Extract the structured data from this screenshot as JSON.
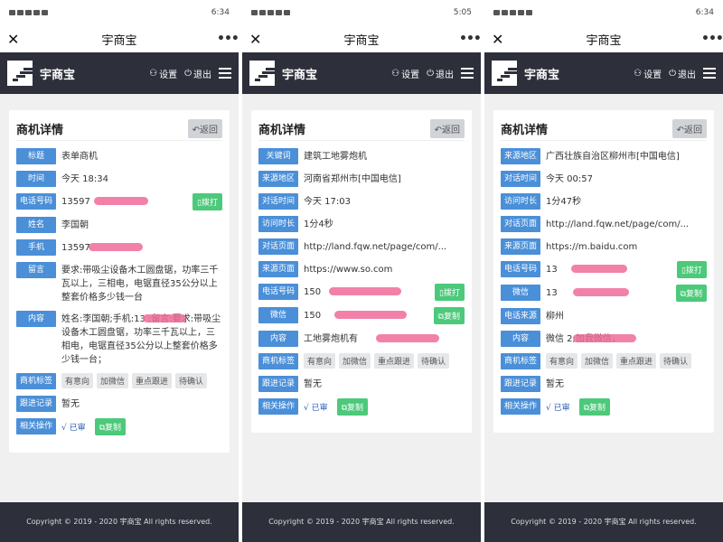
{
  "screens": [
    {
      "status_time": "6:34",
      "title": "宇商宝",
      "app_name": "宇商宝",
      "settings": "设置",
      "logout": "退出",
      "card_title": "商机详情",
      "back": "返回",
      "rows": [
        {
          "label": "标题",
          "value": "表单商机"
        },
        {
          "label": "时间",
          "value": "今天 18:34"
        },
        {
          "label": "电话号码",
          "value": "13597",
          "button": "拨打"
        },
        {
          "label": "姓名",
          "value": "李国朝"
        },
        {
          "label": "手机",
          "value": "13597"
        },
        {
          "label": "留言",
          "value": "要求:带吸尘设备木工圆盘锯，功率三千瓦以上，三相电，电锯直径35公分以上整套价格多少钱一台"
        },
        {
          "label": "内容",
          "value": "姓名:李国朝;手机:13 ;留言:要求:带吸尘设备木工圆盘锯，功率三千瓦以上，三相电，电锯直径35公分以上整套价格多少钱一台；"
        }
      ],
      "tag_label": "商机标签",
      "tags": [
        "有意向",
        "加微信",
        "重点跟进",
        "待确认"
      ],
      "follow_label": "跟进记录",
      "follow_value": "暂无",
      "ops_label": "相关操作",
      "audit": "√ 已审",
      "copy": "复制",
      "footer": "Copyright © 2019 - 2020 宇商宝 All rights reserved."
    },
    {
      "status_time": "5:05",
      "title": "宇商宝",
      "app_name": "宇商宝",
      "settings": "设置",
      "logout": "退出",
      "card_title": "商机详情",
      "back": "返回",
      "rows": [
        {
          "label": "关键词",
          "value": "建筑工地雾炮机"
        },
        {
          "label": "来源地区",
          "value": "河南省郑州市[中国电信]"
        },
        {
          "label": "对话时间",
          "value": "今天 17:03"
        },
        {
          "label": "访问时长",
          "value": "1分4秒"
        },
        {
          "label": "对话页面",
          "value": "http://land.fqw.net/page/com/..."
        },
        {
          "label": "来源页面",
          "value": "https://www.so.com"
        },
        {
          "label": "电话号码",
          "value": "150",
          "button": "拨打"
        },
        {
          "label": "微信",
          "value": "150",
          "button": "复制"
        },
        {
          "label": "内容",
          "value": "工地雾炮机有"
        }
      ],
      "tag_label": "商机标签",
      "tags": [
        "有意向",
        "加微信",
        "重点跟进",
        "待确认"
      ],
      "follow_label": "跟进记录",
      "follow_value": "暂无",
      "ops_label": "相关操作",
      "audit": "√ 已审",
      "copy": "复制",
      "footer": "Copyright © 2019 - 2020 宇商宝 All rights reserved."
    },
    {
      "status_time": "6:34",
      "title": "宇商宝",
      "app_name": "宇商宝",
      "settings": "设置",
      "logout": "退出",
      "card_title": "商机详情",
      "back": "返回",
      "rows": [
        {
          "label": "来源地区",
          "value": "广西壮族自治区柳州市[中国电信]"
        },
        {
          "label": "对话时间",
          "value": "今天 00:57"
        },
        {
          "label": "访问时长",
          "value": "1分47秒"
        },
        {
          "label": "对话页面",
          "value": "http://land.fqw.net/page/com/..."
        },
        {
          "label": "来源页面",
          "value": "https://m.baidu.com"
        },
        {
          "label": "电话号码",
          "value": "13",
          "button": "拨打"
        },
        {
          "label": "微信",
          "value": "13",
          "button": "复制"
        },
        {
          "label": "电话来源",
          "value": "柳州"
        },
        {
          "label": "内容",
          "value": "微信 2;加我微信，"
        }
      ],
      "tag_label": "商机标签",
      "tags": [
        "有意向",
        "加微信",
        "重点跟进",
        "待确认"
      ],
      "follow_label": "跟进记录",
      "follow_value": "暂无",
      "ops_label": "相关操作",
      "audit": "√ 已审",
      "copy": "复制",
      "footer": "Copyright © 2019 - 2020 宇商宝 All rights reserved."
    }
  ]
}
